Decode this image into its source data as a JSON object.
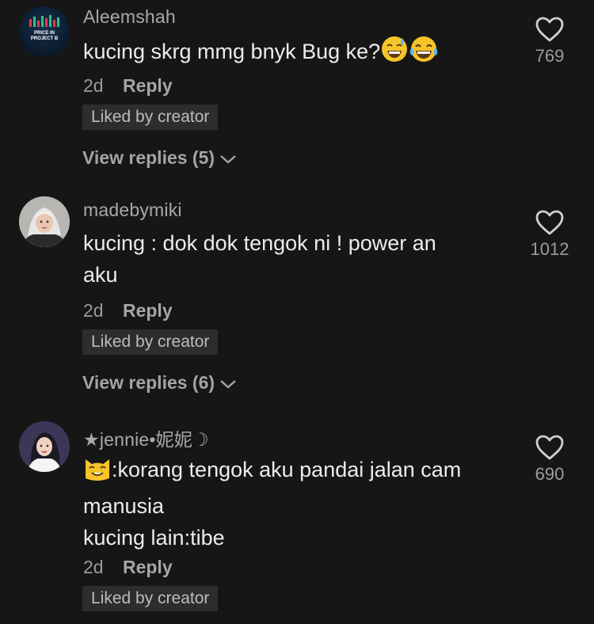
{
  "comments": [
    {
      "username": "Aleemshah",
      "avatar_text": "PRICE IN PROJECT B",
      "text": "kucing skrg mmg bnyk Bug ke?",
      "emojis": [
        "grinning-sweat-emoji",
        "tears-of-joy-emoji"
      ],
      "age": "2d",
      "reply_label": "Reply",
      "liked_badge": "Liked by creator",
      "view_replies": "View replies (5)",
      "like_count": "769"
    },
    {
      "username": "madebymiki",
      "text_line1": "kucing : dok dok tengok ni ! power an",
      "text_line2": "aku",
      "age": "2d",
      "reply_label": "Reply",
      "liked_badge": "Liked by creator",
      "view_replies": "View replies (6)",
      "like_count": "1012"
    },
    {
      "username": "★jennie•妮妮☽",
      "lead_emoji": "cat-smiling-emoji",
      "text_line1": ":korang tengok aku pandai jalan cam",
      "text_line2": "manusia",
      "text_line3": "kucing lain:tibe",
      "age": "2d",
      "reply_label": "Reply",
      "liked_badge": "Liked by creator",
      "like_count": "690"
    }
  ],
  "colors": {
    "background": "#161616",
    "badge_bg": "#2d2d2d",
    "secondary_text": "#a9a9a9"
  }
}
